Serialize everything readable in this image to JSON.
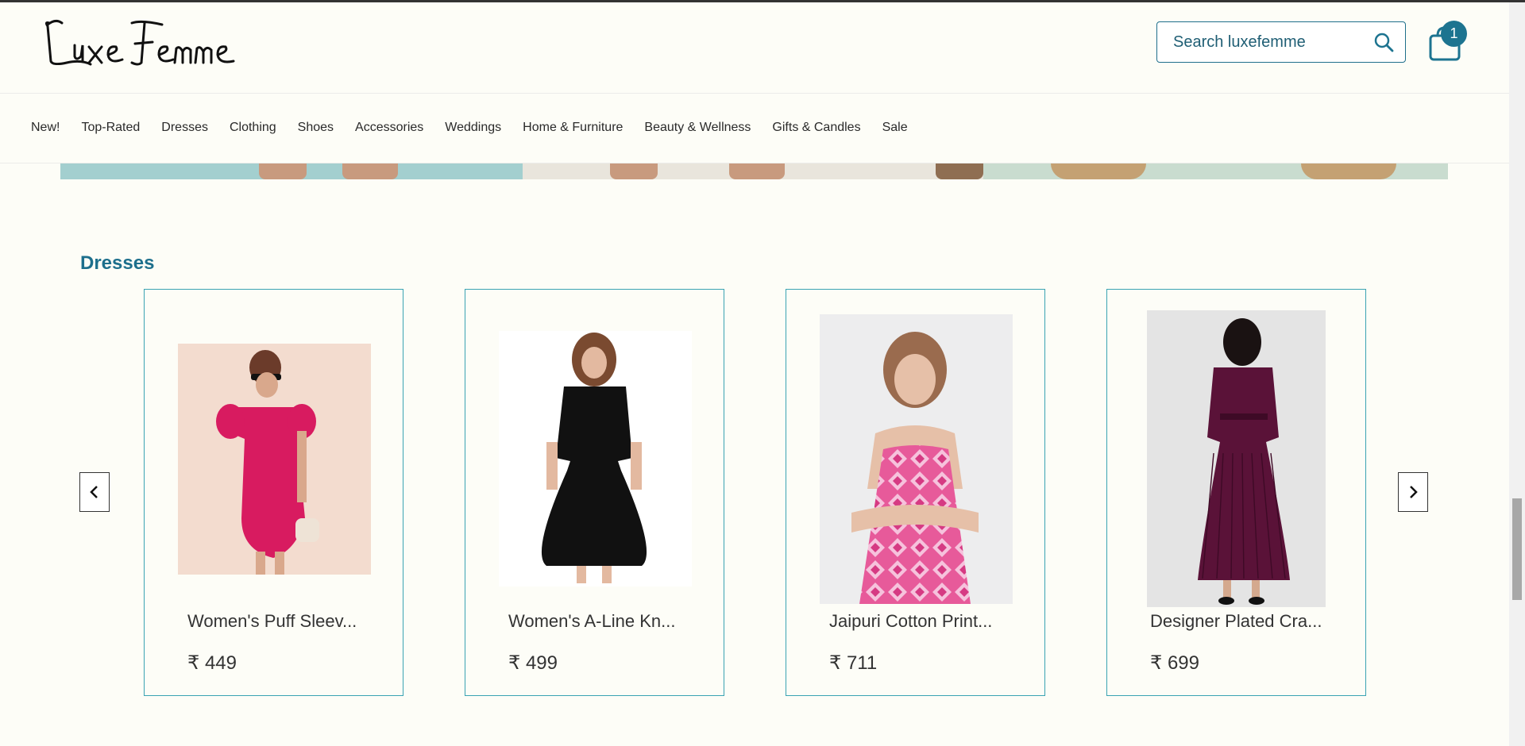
{
  "header": {
    "logo_text": "LuxeFemme",
    "search_placeholder": "Search luxefemme",
    "search_value": "",
    "cart_count": "1",
    "accent_color": "#1d7490"
  },
  "nav": {
    "items": [
      "New!",
      "Top-Rated",
      "Dresses",
      "Clothing",
      "Shoes",
      "Accessories",
      "Weddings",
      "Home & Furniture",
      "Beauty & Wellness",
      "Gifts & Candles",
      "Sale"
    ]
  },
  "section": {
    "title": "Dresses",
    "prev_icon": "chevron-left-icon",
    "next_icon": "chevron-right-icon"
  },
  "products": [
    {
      "name": "Women's Puff Sleev...",
      "price": "₹ 449",
      "dress_color": "#d81b60",
      "bg_color": "#f3dccf"
    },
    {
      "name": "Women's A-Line Kn...",
      "price": "₹ 499",
      "dress_color": "#111111",
      "bg_color": "#ffffff"
    },
    {
      "name": "Jaipuri Cotton Print...",
      "price": "₹ 711",
      "dress_color": "#e75a9a",
      "bg_color": "#ededee"
    },
    {
      "name": "Designer Plated Cra...",
      "price": "₹ 699",
      "dress_color": "#5a1238",
      "bg_color": "#e4e4e4"
    }
  ]
}
